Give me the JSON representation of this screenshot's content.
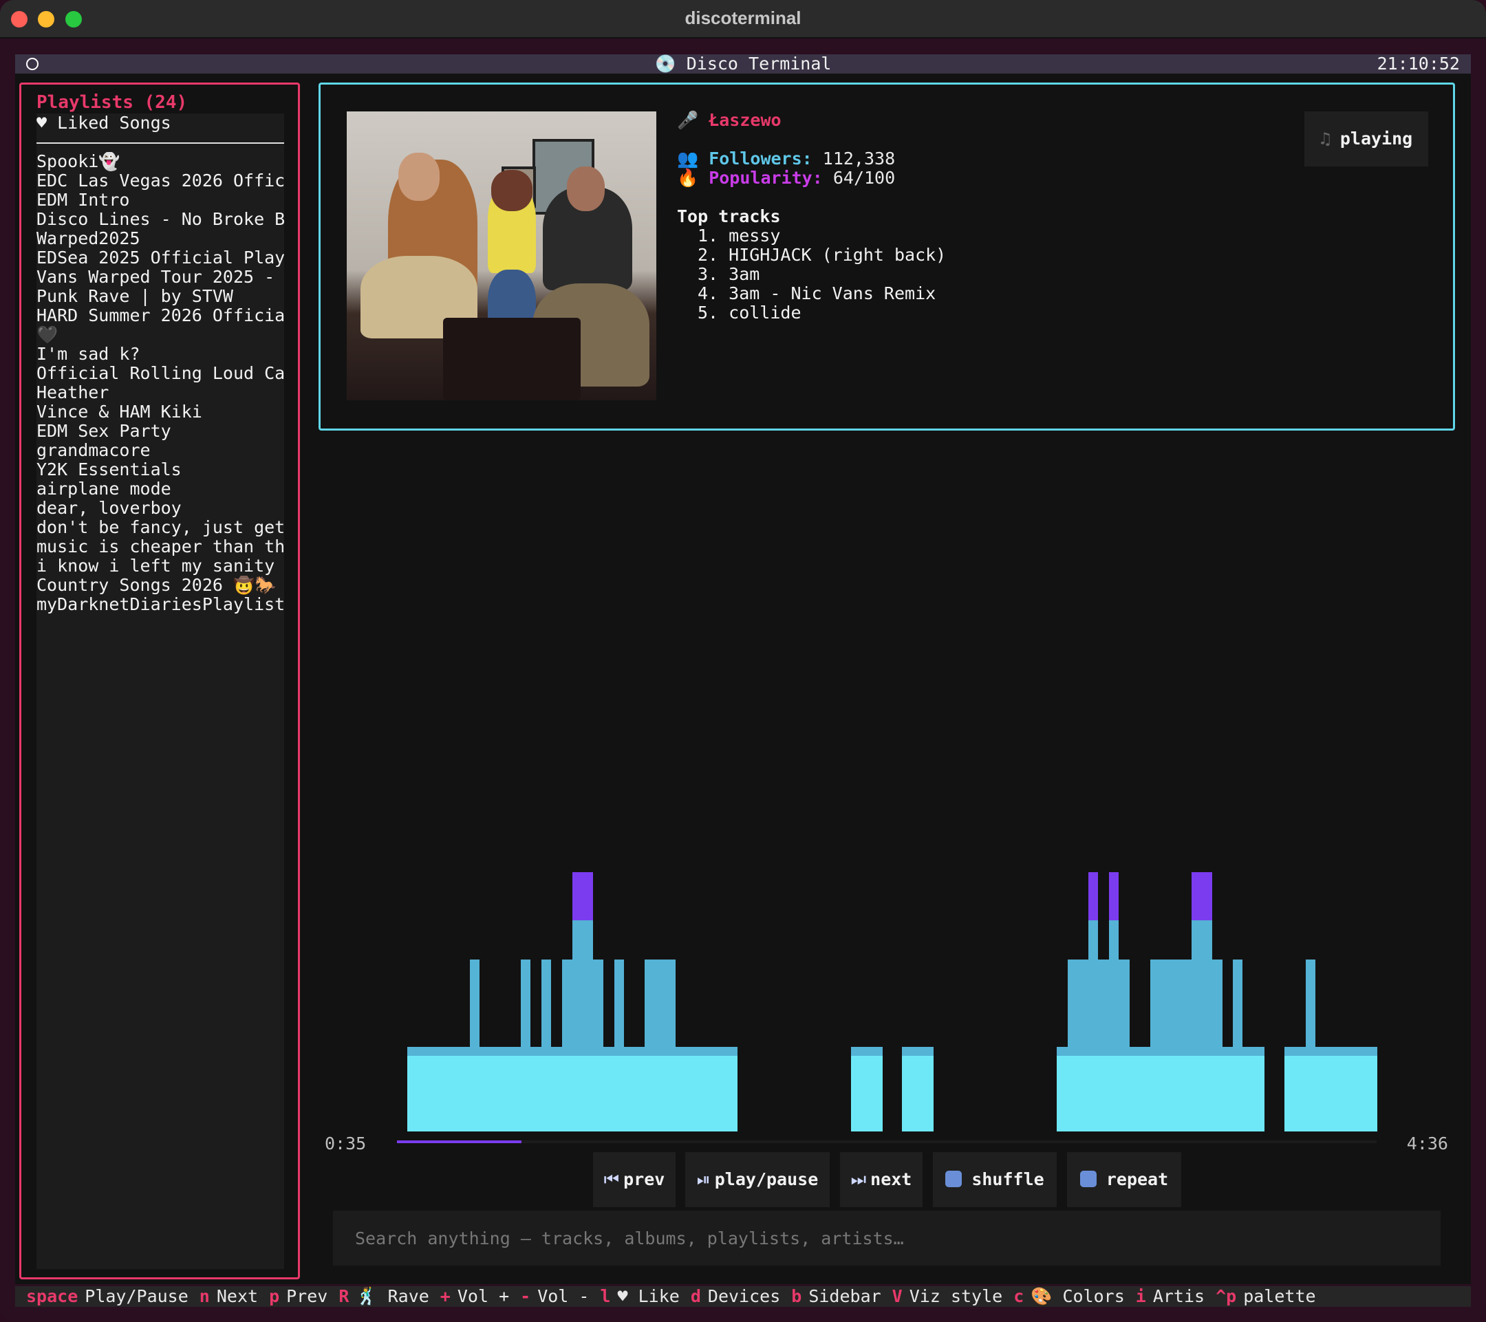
{
  "window": {
    "title": "discoterminal"
  },
  "header": {
    "title": "💿 Disco Terminal",
    "clock": "21:10:52"
  },
  "sidebar": {
    "title": "Playlists (24)",
    "liked": "♥ Liked Songs",
    "items": [
      "Spooki👻",
      "EDC Las Vegas 2026 Offic",
      "EDM Intro",
      "Disco Lines - No Broke B",
      "Warped2025",
      "EDSea 2025 Official Play",
      "Vans Warped Tour 2025 -",
      "Punk Rave | by STVW",
      "HARD Summer 2026 Officia",
      "🖤",
      "I'm sad k?",
      "Official Rolling Loud Ca",
      "Heather",
      "Vince & HAM Kiki",
      "EDM Sex Party",
      "grandmacore",
      "Y2K Essentials",
      "airplane mode",
      "dear, loverboy",
      "don't be fancy, just get",
      "music is cheaper than th",
      "i know i left my sanity",
      "Country Songs 2026   🤠🐎",
      "myDarknetDiariesPlaylist"
    ]
  },
  "artist": {
    "mic_icon": "🎤",
    "name": "Łaszewo",
    "followers_icon": "👥",
    "followers_label": "Followers:",
    "followers_value": "112,338",
    "popularity_icon": "🔥",
    "popularity_label": "Popularity:",
    "popularity_value": "64/100",
    "top_tracks_heading": "Top tracks",
    "top_tracks": [
      "1. messy",
      "2. HIGHJACK (right back)",
      "3. 3am",
      "4. 3am - Nic Vans Remix",
      "5. collide"
    ],
    "status_icon": "♫",
    "status": "playing"
  },
  "player": {
    "elapsed": "0:35",
    "duration": "4:36",
    "progress_fraction": 0.127
  },
  "controls": {
    "prev_icon": "⏮",
    "prev": "prev",
    "play_icon": "⏯",
    "play_pause": "play/pause",
    "next_icon": "⏭",
    "next": "next",
    "shuffle": "shuffle",
    "repeat": "repeat"
  },
  "search": {
    "placeholder": "Search anything — tracks, albums, playlists, artists…"
  },
  "colors": {
    "accent_pink": "#e8396a",
    "accent_cyan": "#5fd7e8",
    "accent_purple": "#7b3cf0",
    "viz_low": "#6ee8f7",
    "viz_mid": "#55b3d6",
    "viz_high": "#7b3cf0"
  },
  "footer": [
    {
      "key": "space",
      "label": "Play/Pause"
    },
    {
      "key": "n",
      "label": "Next"
    },
    {
      "key": "p",
      "label": "Prev"
    },
    {
      "key": "R",
      "label": "🕺 Rave"
    },
    {
      "key": "+",
      "label": "Vol +"
    },
    {
      "key": "-",
      "label": "Vol -"
    },
    {
      "key": "l",
      "label": "♥ Like"
    },
    {
      "key": "d",
      "label": "Devices"
    },
    {
      "key": "b",
      "label": "Sidebar"
    },
    {
      "key": "V",
      "label": "Viz style"
    },
    {
      "key": "c",
      "label": "🎨 Colors"
    },
    {
      "key": "i",
      "label": "Artis"
    },
    {
      "key": "^p",
      "label": "palette"
    }
  ]
}
